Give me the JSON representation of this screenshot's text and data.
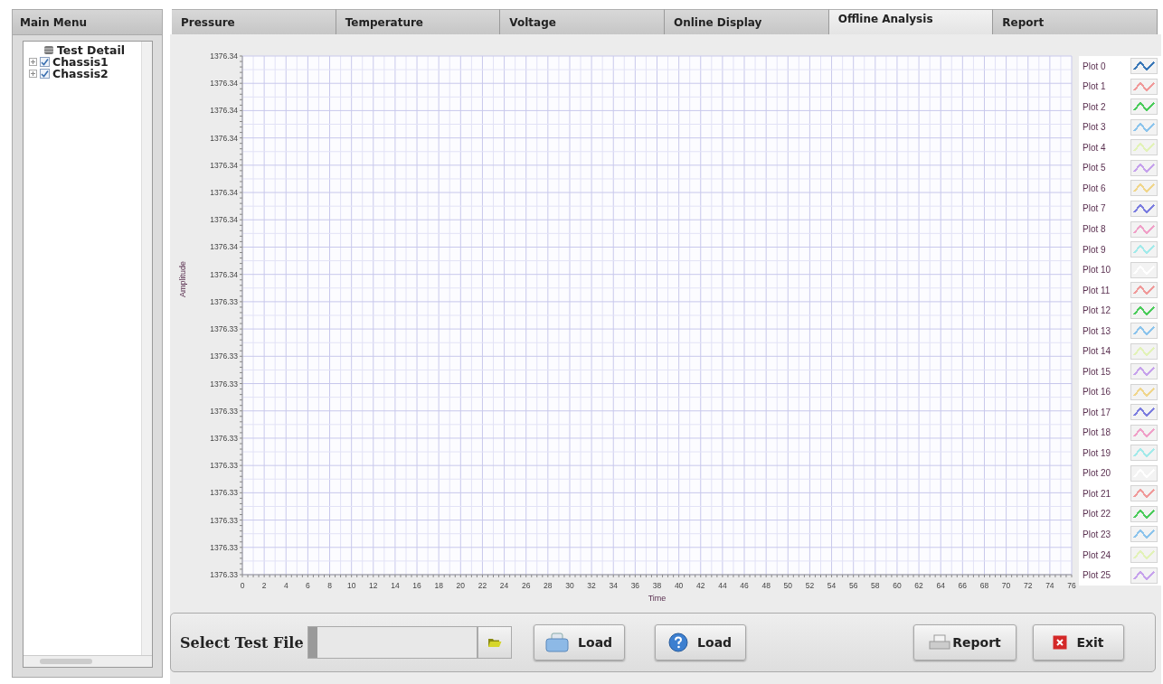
{
  "left_panel": {
    "title": "Main Menu",
    "tree": [
      {
        "label": "Test Detail",
        "kind": "root",
        "children": [
          {
            "label": "Chassis1",
            "kind": "item",
            "checked": true,
            "expanded": false
          },
          {
            "label": "Chassis2",
            "kind": "item",
            "checked": true,
            "expanded": false
          }
        ]
      }
    ]
  },
  "tabs": [
    {
      "label": "Pressure",
      "selected": false
    },
    {
      "label": "Temperature",
      "selected": false
    },
    {
      "label": "Voltage",
      "selected": false
    },
    {
      "label": "Online Display",
      "selected": false
    },
    {
      "label": "Offline Analysis",
      "selected": true
    },
    {
      "label": "Report",
      "selected": false
    }
  ],
  "chart": {
    "chart_data": {
      "type": "line",
      "xlabel": "Time",
      "ylabel": "Amplitude",
      "xlim": [
        0,
        76
      ],
      "ylim": [
        1376.32515,
        1376.3432
      ],
      "xticks": [
        0,
        2,
        4,
        6,
        8,
        10,
        12,
        14,
        16,
        18,
        20,
        22,
        24,
        26,
        28,
        30,
        32,
        34,
        36,
        38,
        40,
        42,
        44,
        46,
        48,
        50,
        52,
        54,
        56,
        58,
        60,
        62,
        64,
        66,
        68,
        70,
        72,
        74,
        76
      ],
      "grid": true,
      "yticks": [
        {
          "value": 1376.3432,
          "label": "1376.34"
        },
        {
          "value": 1376.34225,
          "label": "1376.34"
        },
        {
          "value": 1376.3413,
          "label": "1376.34"
        },
        {
          "value": 1376.34035,
          "label": "1376.34"
        },
        {
          "value": 1376.3394,
          "label": "1376.34"
        },
        {
          "value": 1376.33845,
          "label": "1376.34"
        },
        {
          "value": 1376.3375,
          "label": "1376.34"
        },
        {
          "value": 1376.33655,
          "label": "1376.34"
        },
        {
          "value": 1376.3356,
          "label": "1376.34"
        },
        {
          "value": 1376.33465,
          "label": "1376.33"
        },
        {
          "value": 1376.3337,
          "label": "1376.33"
        },
        {
          "value": 1376.33275,
          "label": "1376.33"
        },
        {
          "value": 1376.3318,
          "label": "1376.33"
        },
        {
          "value": 1376.33085,
          "label": "1376.33"
        },
        {
          "value": 1376.3299,
          "label": "1376.33"
        },
        {
          "value": 1376.32895,
          "label": "1376.33"
        },
        {
          "value": 1376.328,
          "label": "1376.33"
        },
        {
          "value": 1376.32705,
          "label": "1376.33"
        },
        {
          "value": 1376.3261,
          "label": "1376.33"
        },
        {
          "value": 1376.32515,
          "label": "1376.33"
        }
      ]
    },
    "legend": [
      {
        "label": "Plot 0",
        "color": "#3a78b8"
      },
      {
        "label": "Plot 1",
        "color": "#f09a9a"
      },
      {
        "label": "Plot 2",
        "color": "#4ccc5c"
      },
      {
        "label": "Plot 3",
        "color": "#8cc4ec"
      },
      {
        "label": "Plot 4",
        "color": "#e2f2b8"
      },
      {
        "label": "Plot 5",
        "color": "#c6a2ec"
      },
      {
        "label": "Plot 6",
        "color": "#f0d68c"
      },
      {
        "label": "Plot 7",
        "color": "#7c7ee0"
      },
      {
        "label": "Plot 8",
        "color": "#f0a0c8"
      },
      {
        "label": "Plot 9",
        "color": "#a2eaea"
      },
      {
        "label": "Plot 10",
        "color": "#ffffff"
      },
      {
        "label": "Plot 11",
        "color": "#f09a9a"
      },
      {
        "label": "Plot 12",
        "color": "#4ccc5c"
      },
      {
        "label": "Plot 13",
        "color": "#8cc4ec"
      },
      {
        "label": "Plot 14",
        "color": "#e2f2b8"
      },
      {
        "label": "Plot 15",
        "color": "#c6a2ec"
      },
      {
        "label": "Plot 16",
        "color": "#f0d68c"
      },
      {
        "label": "Plot 17",
        "color": "#7c7ee0"
      },
      {
        "label": "Plot 18",
        "color": "#f0a0c8"
      },
      {
        "label": "Plot 19",
        "color": "#a2eaea"
      },
      {
        "label": "Plot 20",
        "color": "#ffffff"
      },
      {
        "label": "Plot 21",
        "color": "#f09a9a"
      },
      {
        "label": "Plot 22",
        "color": "#4ccc5c"
      },
      {
        "label": "Plot 23",
        "color": "#8cc4ec"
      },
      {
        "label": "Plot 24",
        "color": "#e2f2b8"
      },
      {
        "label": "Plot 25",
        "color": "#c6a2ec"
      }
    ]
  },
  "file_bar": {
    "label": "Select Test File",
    "buttons": [
      {
        "label": "Load",
        "kind": "open"
      },
      {
        "label": "Load",
        "kind": "help"
      },
      {
        "label": "Report",
        "kind": "report"
      },
      {
        "label": "Exit",
        "kind": "exit"
      }
    ]
  }
}
